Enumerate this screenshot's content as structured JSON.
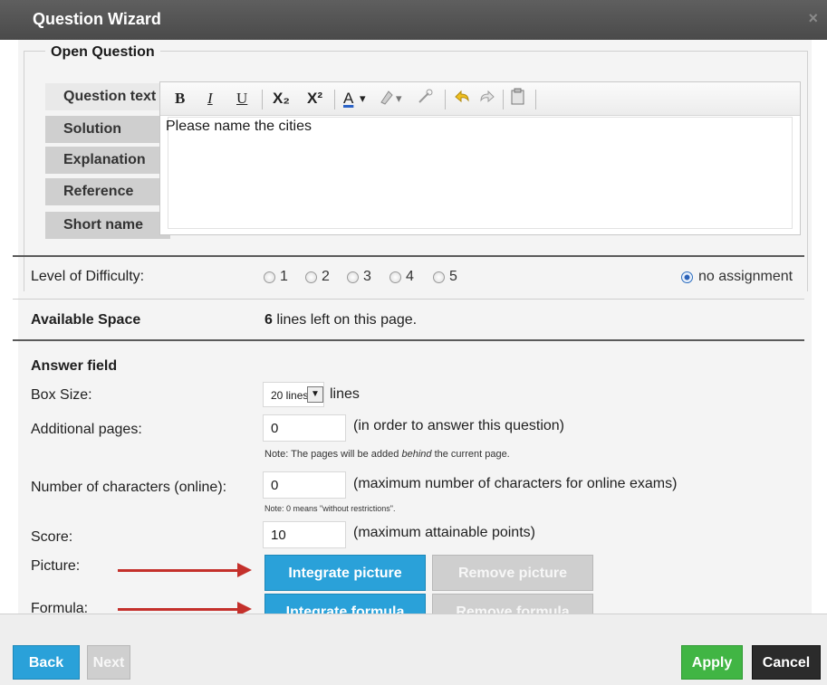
{
  "window": {
    "title": "Question Wizard",
    "close_glyph": "×"
  },
  "section": {
    "legend": "Open Question"
  },
  "tabs": [
    "Question text",
    "Solution",
    "Explanation",
    "Reference",
    "Short name"
  ],
  "editor": {
    "toolbar": {
      "bold": "B",
      "italic": "I",
      "underline": "U",
      "subscript": "X₂",
      "superscript": "X²",
      "font_color": "A",
      "dropdown": "▾"
    },
    "content": "Please name the cities"
  },
  "difficulty": {
    "label": "Level of Difficulty:",
    "options": [
      "1",
      "2",
      "3",
      "4",
      "5"
    ],
    "no_assignment": "no assignment",
    "selected": "no assignment"
  },
  "space": {
    "label": "Available Space",
    "value_bold": "6",
    "value_rest": " lines left on this page."
  },
  "answer": {
    "heading": "Answer field",
    "box_size_label": "Box Size:",
    "box_size_value": "20 lines",
    "box_size_suffix": "lines",
    "additional_label": "Additional pages:",
    "additional_value": "0",
    "additional_hint": "(in order to answer this question)",
    "note_pages_before": "Note: The pages will be added ",
    "note_pages_em": "behind",
    "note_pages_after": " the current page.",
    "chars_label": "Number of characters (online):",
    "chars_value": "0",
    "chars_hint": "(maximum number of characters for online exams)",
    "note_chars": "Note: 0 means \"without restrictions\".",
    "score_label": "Score:",
    "score_value": "10",
    "score_hint": "(maximum attainable points)",
    "picture_label": "Picture:",
    "integrate_picture": "Integrate picture",
    "remove_picture": "Remove picture",
    "formula_label": "Formula:",
    "integrate_formula": "Integrate formula",
    "remove_formula": "Remove formula"
  },
  "footer": {
    "back": "Back",
    "next": "Next",
    "apply": "Apply",
    "cancel": "Cancel"
  },
  "colors": {
    "blue": "#2aa1d9",
    "green": "#41b544",
    "dark": "#2b2b2b",
    "arrow": "#c4302b"
  }
}
